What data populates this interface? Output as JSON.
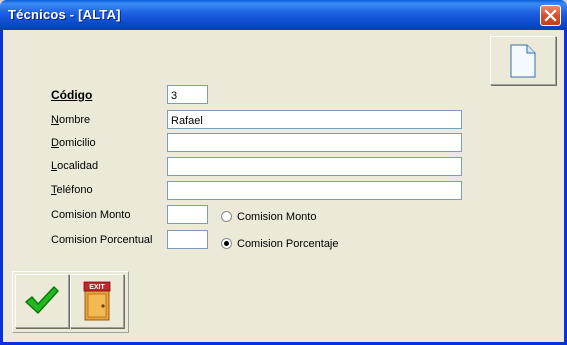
{
  "window": {
    "title": "Técnicos - [ALTA]"
  },
  "form": {
    "codigo": {
      "label": "Código",
      "value": "3"
    },
    "nombre": {
      "label_u": "N",
      "label_rest": "ombre",
      "value": "Rafael"
    },
    "domicilio": {
      "label_u": "D",
      "label_rest": "omicilio",
      "value": ""
    },
    "localidad": {
      "label_u": "L",
      "label_rest": "ocalidad",
      "value": ""
    },
    "telefono": {
      "label_u": "T",
      "label_rest": "eléfono",
      "value": ""
    },
    "comision_monto": {
      "label": "Comision Monto",
      "value": ""
    },
    "comision_porcentual": {
      "label": "Comision Porcentual",
      "value": ""
    }
  },
  "options": {
    "monto": {
      "label": "Comision Monto",
      "checked": false
    },
    "porcentaje": {
      "label": "Comision Porcentaje",
      "checked": true
    }
  },
  "buttons": {
    "new_icon": "document-icon",
    "accept_icon": "checkmark-icon",
    "exit_icon": "exit-door-icon",
    "exit_text": "EXIT"
  }
}
